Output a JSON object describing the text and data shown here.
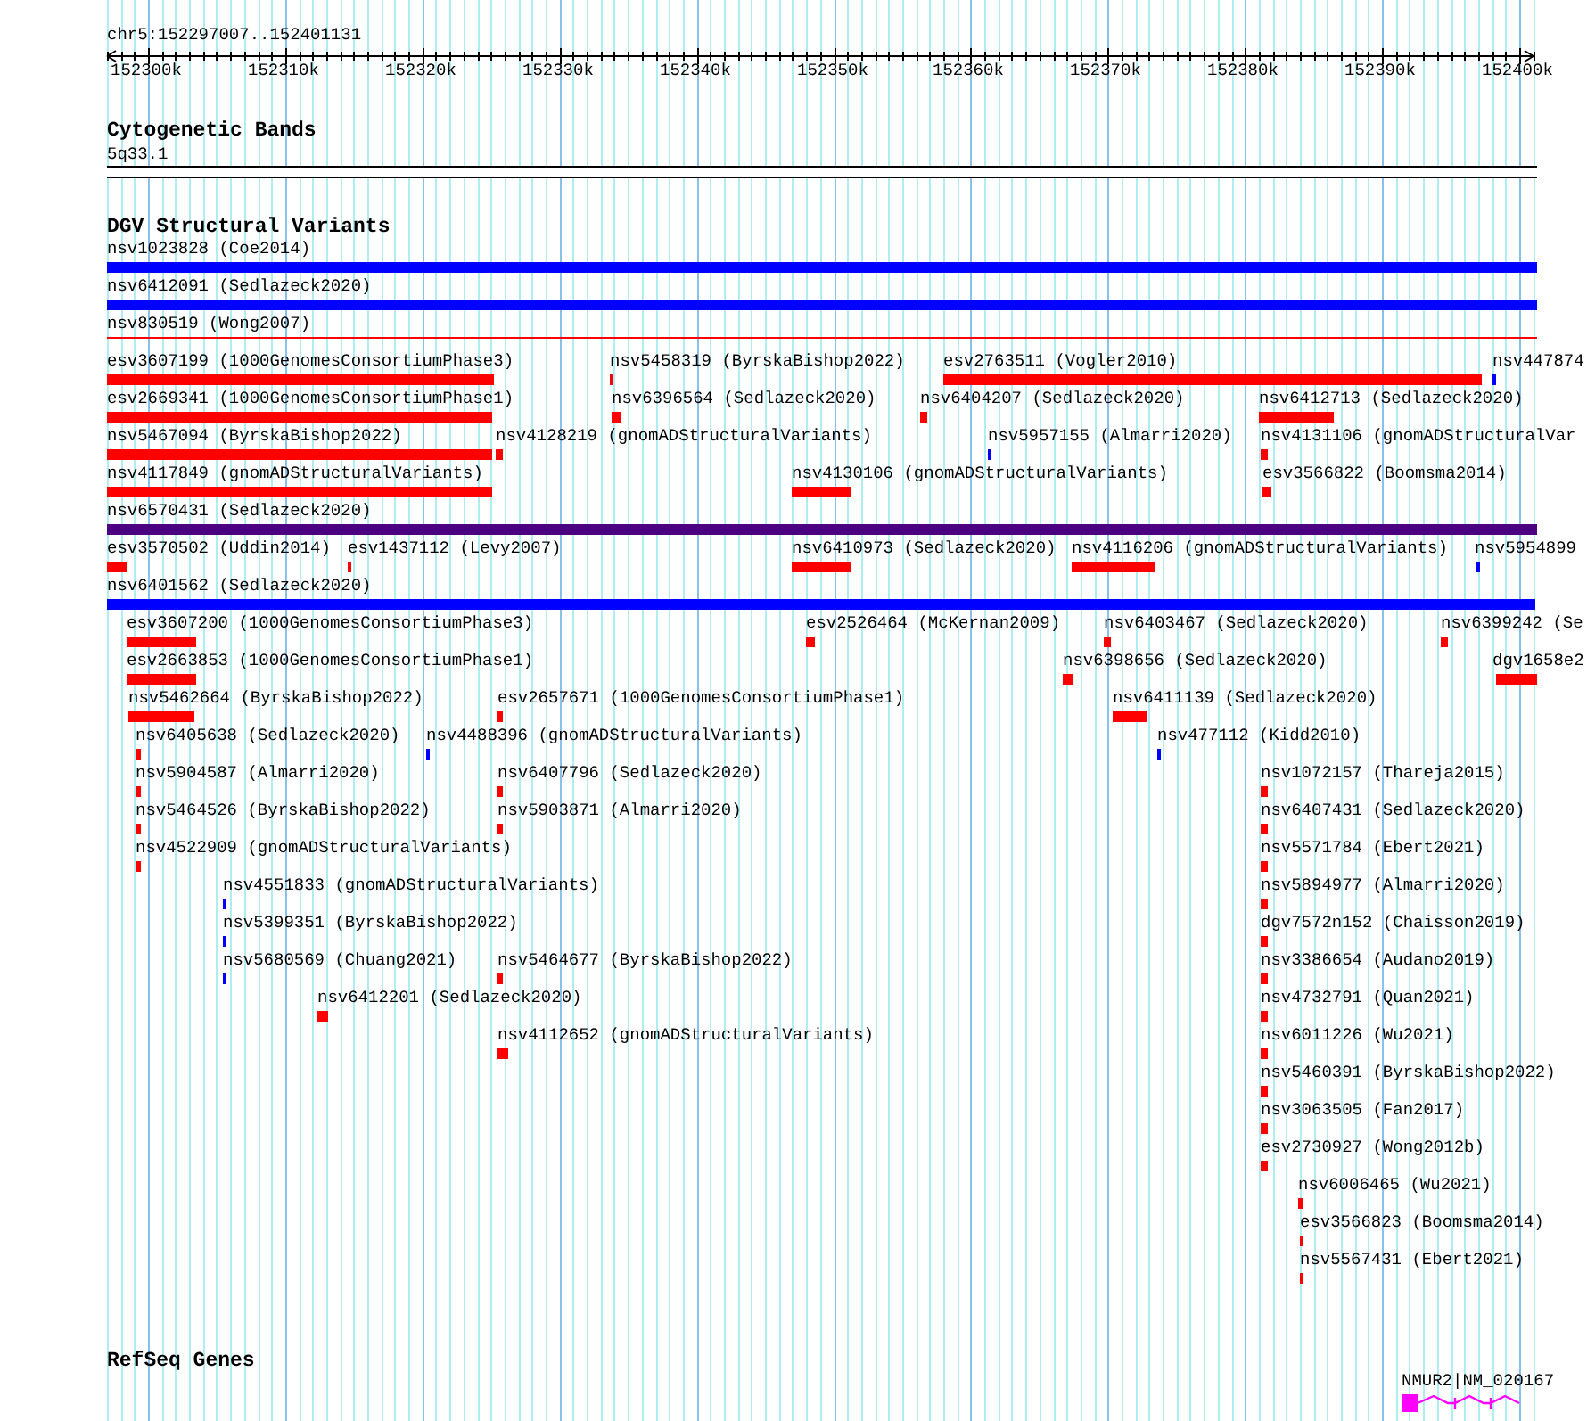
{
  "location": "chr5:152297007..152401131",
  "ruler": {
    "ticks": [
      "152300k",
      "152310k",
      "152320k",
      "152330k",
      "152340k",
      "152350k",
      "152360k",
      "152370k",
      "152380k",
      "152390k",
      "152400k"
    ]
  },
  "cytoband_track": {
    "title": "Cytogenetic Bands",
    "band": "5q33.1"
  },
  "dgv_track": {
    "title": "DGV Structural Variants",
    "features": [
      {
        "label": "nsv1023828 (Coe2014)",
        "color": "#0000ff"
      },
      {
        "label": "nsv6412091 (Sedlazeck2020)",
        "color": "#0000ff"
      },
      {
        "label": "nsv830519 (Wong2007)",
        "color": "#ff0000"
      },
      {
        "label": "esv3607199 (1000GenomesConsortiumPhase3)",
        "color": "#ff0000"
      },
      {
        "label": "nsv5458319 (ByrskaBishop2022)",
        "color": "#ff0000"
      },
      {
        "label": "esv2763511 (Vogler2010)",
        "color": "#ff0000"
      },
      {
        "label": "nsv447874",
        "color": "#0000ff"
      },
      {
        "label": "esv2669341 (1000GenomesConsortiumPhase1)",
        "color": "#ff0000"
      },
      {
        "label": "nsv6396564 (Sedlazeck2020)",
        "color": "#ff0000"
      },
      {
        "label": "nsv6404207 (Sedlazeck2020)",
        "color": "#ff0000"
      },
      {
        "label": "nsv6412713 (Sedlazeck2020)",
        "color": "#ff0000"
      },
      {
        "label": "nsv5467094 (ByrskaBishop2022)",
        "color": "#ff0000"
      },
      {
        "label": "nsv4128219 (gnomADStructuralVariants)",
        "color": "#ff0000"
      },
      {
        "label": "nsv5957155 (Almarri2020)",
        "color": "#0000ff"
      },
      {
        "label": "nsv4131106 (gnomADStructuralVar",
        "color": "#ff0000"
      },
      {
        "label": "nsv4117849 (gnomADStructuralVariants)",
        "color": "#ff0000"
      },
      {
        "label": "nsv4130106 (gnomADStructuralVariants)",
        "color": "#ff0000"
      },
      {
        "label": "esv3566822 (Boomsma2014)",
        "color": "#ff0000"
      },
      {
        "label": "nsv6570431 (Sedlazeck2020)",
        "color": "#4b0082"
      },
      {
        "label": "esv3570502 (Uddin2014)",
        "color": "#ff0000"
      },
      {
        "label": "esv1437112 (Levy2007)",
        "color": "#ff0000"
      },
      {
        "label": "nsv6410973 (Sedlazeck2020)",
        "color": "#ff0000"
      },
      {
        "label": "nsv4116206 (gnomADStructuralVariants)",
        "color": "#ff0000"
      },
      {
        "label": "nsv5954899",
        "color": "#0000ff"
      },
      {
        "label": "nsv6401562 (Sedlazeck2020)",
        "color": "#0000ff"
      },
      {
        "label": "esv3607200 (1000GenomesConsortiumPhase3)",
        "color": "#ff0000"
      },
      {
        "label": "esv2526464 (McKernan2009)",
        "color": "#ff0000"
      },
      {
        "label": "nsv6403467 (Sedlazeck2020)",
        "color": "#ff0000"
      },
      {
        "label": "nsv6399242 (Se",
        "color": "#ff0000"
      },
      {
        "label": "esv2663853 (1000GenomesConsortiumPhase1)",
        "color": "#ff0000"
      },
      {
        "label": "nsv6398656 (Sedlazeck2020)",
        "color": "#ff0000"
      },
      {
        "label": "dgv1658e2",
        "color": "#ff0000"
      },
      {
        "label": "nsv5462664 (ByrskaBishop2022)",
        "color": "#ff0000"
      },
      {
        "label": "esv2657671 (1000GenomesConsortiumPhase1)",
        "color": "#ff0000"
      },
      {
        "label": "nsv6411139 (Sedlazeck2020)",
        "color": "#ff0000"
      },
      {
        "label": "nsv6405638 (Sedlazeck2020)",
        "color": "#ff0000"
      },
      {
        "label": "nsv4488396 (gnomADStructuralVariants)",
        "color": "#0000ff"
      },
      {
        "label": "nsv477112 (Kidd2010)",
        "color": "#0000ff"
      },
      {
        "label": "nsv5904587 (Almarri2020)",
        "color": "#ff0000"
      },
      {
        "label": "nsv6407796 (Sedlazeck2020)",
        "color": "#ff0000"
      },
      {
        "label": "nsv1072157 (Thareja2015)",
        "color": "#ff0000"
      },
      {
        "label": "nsv5464526 (ByrskaBishop2022)",
        "color": "#ff0000"
      },
      {
        "label": "nsv5903871 (Almarri2020)",
        "color": "#ff0000"
      },
      {
        "label": "nsv6407431 (Sedlazeck2020)",
        "color": "#ff0000"
      },
      {
        "label": "nsv4522909 (gnomADStructuralVariants)",
        "color": "#ff0000"
      },
      {
        "label": "nsv5571784 (Ebert2021)",
        "color": "#ff0000"
      },
      {
        "label": "nsv4551833 (gnomADStructuralVariants)",
        "color": "#0000ff"
      },
      {
        "label": "nsv5894977 (Almarri2020)",
        "color": "#ff0000"
      },
      {
        "label": "nsv5399351 (ByrskaBishop2022)",
        "color": "#0000ff"
      },
      {
        "label": "dgv7572n152 (Chaisson2019)",
        "color": "#ff0000"
      },
      {
        "label": "nsv5680569 (Chuang2021)",
        "color": "#0000ff"
      },
      {
        "label": "nsv5464677 (ByrskaBishop2022)",
        "color": "#ff0000"
      },
      {
        "label": "nsv3386654 (Audano2019)",
        "color": "#ff0000"
      },
      {
        "label": "nsv6412201 (Sedlazeck2020)",
        "color": "#ff0000"
      },
      {
        "label": "nsv4732791 (Quan2021)",
        "color": "#ff0000"
      },
      {
        "label": "nsv4112652 (gnomADStructuralVariants)",
        "color": "#ff0000"
      },
      {
        "label": "nsv6011226 (Wu2021)",
        "color": "#ff0000"
      },
      {
        "label": "nsv5460391 (ByrskaBishop2022)",
        "color": "#ff0000"
      },
      {
        "label": "nsv3063505 (Fan2017)",
        "color": "#ff0000"
      },
      {
        "label": "esv2730927 (Wong2012b)",
        "color": "#ff0000"
      },
      {
        "label": "nsv6006465 (Wu2021)",
        "color": "#ff0000"
      },
      {
        "label": "esv3566823 (Boomsma2014)",
        "color": "#ff0000"
      },
      {
        "label": "nsv5567431 (Ebert2021)",
        "color": "#ff0000"
      }
    ]
  },
  "refseq_track": {
    "title": "RefSeq Genes",
    "genes": [
      {
        "label": "NMUR2|NM_020167"
      }
    ]
  }
}
